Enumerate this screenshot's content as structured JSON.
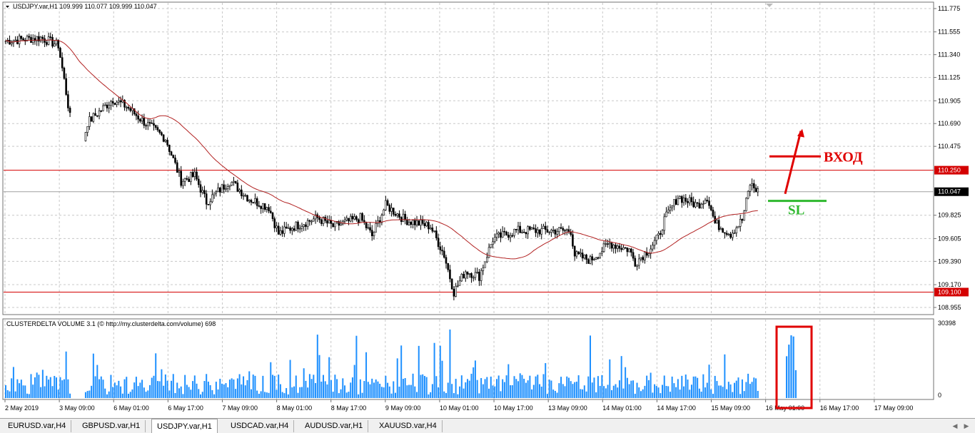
{
  "main_chart": {
    "header": {
      "symbol_timeframe": "USDJPY.var,H1",
      "ohlc": "109.999 110.077 109.999 110.047"
    },
    "price_ticks": [
      "111.775",
      "111.555",
      "111.340",
      "111.125",
      "110.905",
      "110.690",
      "110.475",
      "110.250",
      "110.047",
      "109.825",
      "109.605",
      "109.390",
      "109.170",
      "109.100",
      "108.955"
    ],
    "hlines": [
      {
        "label": "110.250",
        "color": "#d40000"
      },
      {
        "label": "109.100",
        "color": "#d40000"
      }
    ],
    "current_price": {
      "label": "110.047"
    },
    "annotations": {
      "entry_label": "ВХОД",
      "stop_loss_label": "SL"
    }
  },
  "indicator": {
    "header": "CLUSTERDELTA VOLUME 3.1 (© http://my.clusterdelta.com/volume) 698",
    "max_label": "30398",
    "min_label": "0",
    "bar_color": "#1e90ff"
  },
  "time_axis": {
    "labels": [
      "2 May 2019",
      "3 May 09:00",
      "6 May 01:00",
      "6 May 17:00",
      "7 May 09:00",
      "8 May 01:00",
      "8 May 17:00",
      "9 May 09:00",
      "10 May 01:00",
      "10 May 17:00",
      "13 May 09:00",
      "14 May 01:00",
      "14 May 17:00",
      "15 May 09:00",
      "16 May 01:00",
      "16 May 17:00",
      "17 May 09:00"
    ]
  },
  "tabs": [
    {
      "label": "EURUSD.var,H4",
      "active": false
    },
    {
      "label": "GBPUSD.var,H1",
      "active": false
    },
    {
      "label": "USDJPY.var,H1",
      "active": true
    },
    {
      "label": "USDCAD.var,H4",
      "active": false
    },
    {
      "label": "AUDUSD.var,H1",
      "active": false
    },
    {
      "label": "XAUUSD.var,H4",
      "active": false
    }
  ],
  "colors": {
    "bull_candle": "#000000",
    "bear_candle": "#000000",
    "ma_line": "#b22222",
    "grid": "#c8c8c8",
    "level_line": "#d40000",
    "entry_arrow": "#e00000",
    "sl_line": "#2eb82e",
    "highlight_box": "#e00000"
  },
  "chart_data": {
    "type": "candlestick",
    "ylim": [
      108.955,
      111.775
    ],
    "levels": [
      110.25,
      109.1
    ],
    "waypoints": [
      [
        0,
        111.47
      ],
      [
        18,
        111.5
      ],
      [
        27,
        111.43
      ],
      [
        30,
        111.1
      ],
      [
        33,
        110.75
      ],
      [
        37,
        110.3
      ],
      [
        42,
        110.7
      ],
      [
        55,
        110.92
      ],
      [
        62,
        110.85
      ],
      [
        70,
        110.72
      ],
      [
        82,
        110.55
      ],
      [
        90,
        110.15
      ],
      [
        97,
        110.2
      ],
      [
        103,
        109.95
      ],
      [
        115,
        110.15
      ],
      [
        125,
        109.98
      ],
      [
        135,
        109.9
      ],
      [
        140,
        109.65
      ],
      [
        148,
        109.72
      ],
      [
        160,
        109.8
      ],
      [
        168,
        109.72
      ],
      [
        182,
        109.8
      ],
      [
        188,
        109.63
      ],
      [
        195,
        109.92
      ],
      [
        205,
        109.78
      ],
      [
        218,
        109.72
      ],
      [
        225,
        109.45
      ],
      [
        230,
        109.1
      ],
      [
        236,
        109.3
      ],
      [
        243,
        109.25
      ],
      [
        250,
        109.6
      ],
      [
        262,
        109.68
      ],
      [
        275,
        109.68
      ],
      [
        290,
        109.68
      ],
      [
        292,
        109.45
      ],
      [
        300,
        109.4
      ],
      [
        310,
        109.56
      ],
      [
        320,
        109.5
      ],
      [
        323,
        109.38
      ],
      [
        330,
        109.5
      ],
      [
        335,
        109.62
      ],
      [
        338,
        109.78
      ],
      [
        345,
        110.0
      ],
      [
        355,
        109.92
      ],
      [
        360,
        110.0
      ],
      [
        364,
        109.75
      ],
      [
        372,
        109.65
      ],
      [
        378,
        109.78
      ],
      [
        382,
        110.12
      ],
      [
        386,
        110.05
      ]
    ],
    "volume_highlight_group": [
      18000,
      23000,
      27000,
      26500,
      12000
    ]
  }
}
